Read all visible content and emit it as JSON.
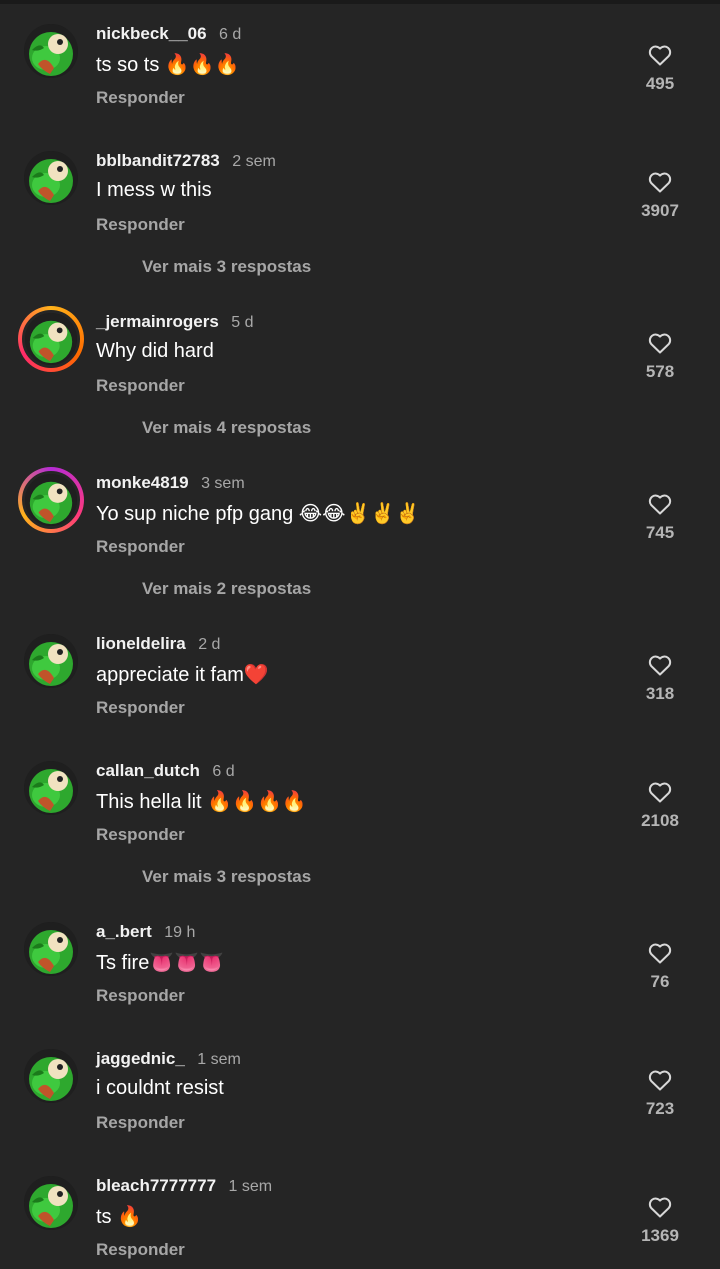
{
  "reply_label": "Responder",
  "comments": [
    {
      "user": "nickbeck__06",
      "time": "6 d",
      "text": "ts so ts 🔥🔥🔥",
      "likes": "495",
      "ring": "none",
      "more": ""
    },
    {
      "user": "bblbandit72783",
      "time": "2 sem",
      "text": "I mess w this",
      "likes": "3907",
      "ring": "none",
      "more": "Ver mais 3 respostas"
    },
    {
      "user": "_jermainrogers",
      "time": "5 d",
      "text": "Why did hard",
      "likes": "578",
      "ring": "orange",
      "more": "Ver mais 4 respostas"
    },
    {
      "user": "monke4819",
      "time": "3 sem",
      "text": "Yo sup niche pfp gang 😂😂✌️✌️✌️",
      "likes": "745",
      "ring": "purple",
      "more": "Ver mais 2 respostas"
    },
    {
      "user": "lioneldelira",
      "time": "2 d",
      "text": "appreciate it fam❤️",
      "likes": "318",
      "ring": "none",
      "more": ""
    },
    {
      "user": "callan_dutch",
      "time": "6 d",
      "text": "This hella lit 🔥🔥🔥🔥",
      "likes": "2108",
      "ring": "none",
      "more": "Ver mais 3 respostas"
    },
    {
      "user": "a_.bert",
      "time": "19 h",
      "text": "Ts fire👅👅👅",
      "likes": "76",
      "ring": "none",
      "more": ""
    },
    {
      "user": "jaggednic_",
      "time": "1 sem",
      "text": "i couldnt resist",
      "likes": "723",
      "ring": "none",
      "more": ""
    },
    {
      "user": "bleach7777777",
      "time": "1 sem",
      "text": "ts 🔥",
      "likes": "1369",
      "ring": "none",
      "more": ""
    }
  ],
  "icons": {
    "avatar": "green-character-avatar-icon",
    "like": "heart-outline-icon"
  },
  "colors": {
    "background": "#252525",
    "secondary_text": "#a6a6a6",
    "ring_orange": "#ff6a00",
    "ring_purple": "#b52bd6"
  }
}
